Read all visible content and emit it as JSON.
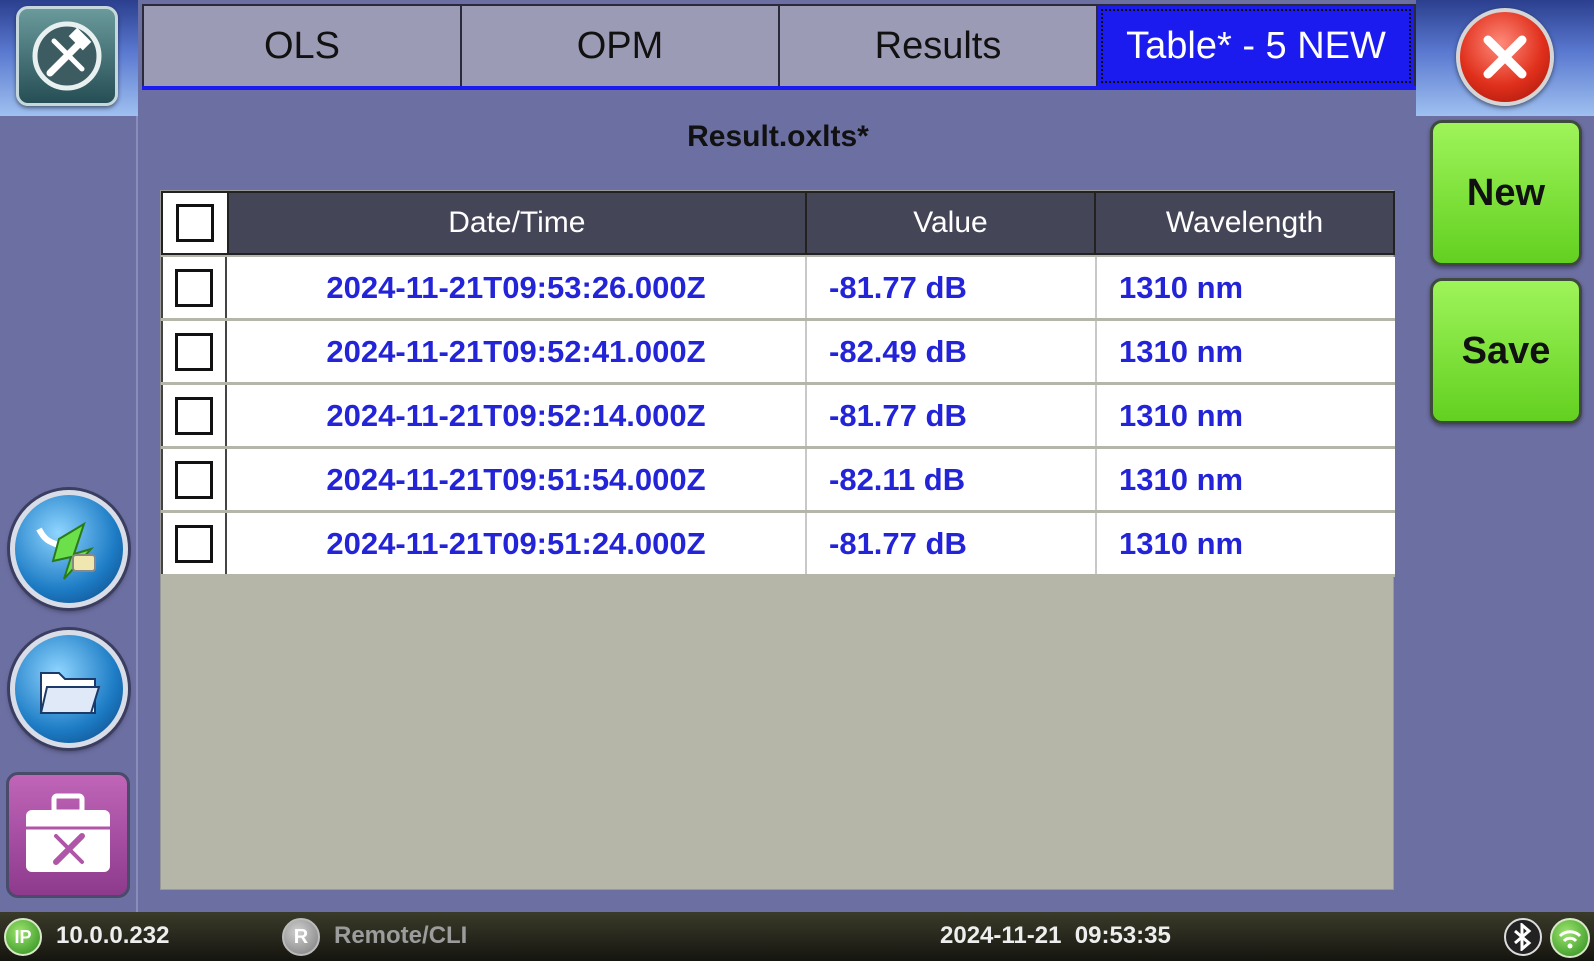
{
  "tabs": [
    {
      "label": "OLS",
      "active": false
    },
    {
      "label": "OPM",
      "active": false
    },
    {
      "label": "Results",
      "active": false
    },
    {
      "label": "Table* - 5 NEW",
      "active": true
    }
  ],
  "file_title": "Result.oxlts*",
  "table": {
    "columns": [
      "Date/Time",
      "Value",
      "Wavelength"
    ],
    "rows": [
      {
        "datetime": "2024-11-21T09:53:26.000Z",
        "value": "-81.77 dB",
        "wavelength": "1310 nm"
      },
      {
        "datetime": "2024-11-21T09:52:41.000Z",
        "value": "-82.49 dB",
        "wavelength": "1310 nm"
      },
      {
        "datetime": "2024-11-21T09:52:14.000Z",
        "value": "-81.77 dB",
        "wavelength": "1310 nm"
      },
      {
        "datetime": "2024-11-21T09:51:54.000Z",
        "value": "-82.11 dB",
        "wavelength": "1310 nm"
      },
      {
        "datetime": "2024-11-21T09:51:24.000Z",
        "value": "-81.77 dB",
        "wavelength": "1310 nm"
      }
    ]
  },
  "actions": {
    "new_label": "New",
    "save_label": "Save"
  },
  "status": {
    "ip_badge": "IP",
    "ip": "10.0.0.232",
    "remote_badge": "R",
    "remote": "Remote/CLI",
    "datetime": "2024-11-21  09:53:35"
  },
  "icons": {
    "tools": "tools-icon",
    "connector": "connector-icon",
    "folder": "folder-icon",
    "toolbox": "toolbox-icon",
    "close": "close-icon",
    "bluetooth": "bluetooth-icon",
    "wifi": "wifi-icon"
  },
  "colors": {
    "background": "#6c6fa2",
    "active_tab": "#1b1bf0",
    "cell_text": "#2323d8",
    "green_button": "#7ee03a",
    "close_red": "#e0301c"
  }
}
